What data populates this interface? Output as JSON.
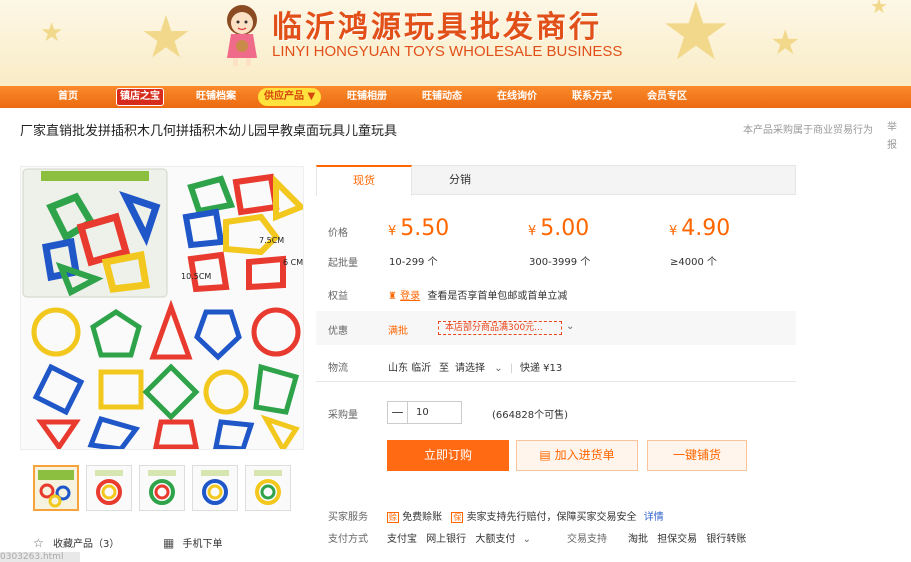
{
  "shop": {
    "name_cn": "临沂鸿源玩具批发商行",
    "name_en": "LINYI HONGYUAN TOYS WHOLESALE BUSINESS"
  },
  "nav": [
    "首页",
    "镇店之宝",
    "旺铺档案",
    "供应产品 ▼",
    "旺铺相册",
    "旺铺动态",
    "在线询价",
    "联系方式",
    "会员专区"
  ],
  "product": {
    "title": "厂家直销批发拼插积木几何拼插积木幼儿园早教桌面玩具儿童玩具",
    "side_note": "本产品采购属于商业贸易行为",
    "report": "举报"
  },
  "image_labels": [
    "7.5CM",
    "10.5CM",
    "6 CM"
  ],
  "tabs": [
    "现货",
    "分销"
  ],
  "pricing": {
    "label_price": "价格",
    "label_moq": "起批量",
    "currency": "¥",
    "tiers": [
      {
        "price": "5.50",
        "qty": "10-299 个"
      },
      {
        "price": "5.00",
        "qty": "300-3999 个"
      },
      {
        "price": "4.90",
        "qty": "≥4000 个"
      }
    ]
  },
  "rights": {
    "label": "权益",
    "login": "登录",
    "text": "查看是否享首单包邮或首单立减"
  },
  "promo": {
    "label": "优惠",
    "tag": "满批",
    "coupon": "本店部分商品满300元..."
  },
  "logistics": {
    "label": "物流",
    "from": "山东 临沂",
    "to_word": "至",
    "select": "请选择",
    "express": "快递 ¥13"
  },
  "purchase": {
    "label": "采购量",
    "minus": "—",
    "value": "10",
    "stock": "(664828个可售)"
  },
  "buttons": {
    "buy": "立即订购",
    "cart": "加入进货单",
    "one_click": "一键铺货"
  },
  "service": {
    "label": "买家服务",
    "item1": "免费赊账",
    "item2": "卖家支持先行赔付，保障买家交易安全",
    "detail": "详情"
  },
  "payment": {
    "label": "支付方式",
    "methods": [
      "支付宝",
      "网上银行",
      "大额支付"
    ],
    "trade_label": "交易支持",
    "trade_methods": [
      "淘批",
      "担保交易",
      "银行转账"
    ]
  },
  "footer": {
    "favorite": "收藏产品（3）",
    "mobile": "手机下单",
    "url": "0303263.html"
  },
  "colors": {
    "brand_orange": "#ff6600",
    "nav_orange": "#f27a1c",
    "shop_red": "#e2501a"
  }
}
